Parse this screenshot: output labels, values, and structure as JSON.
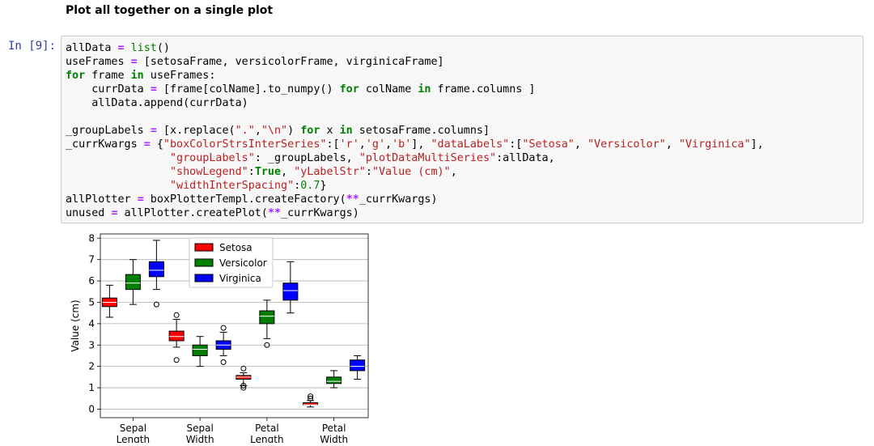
{
  "heading": "Plot all together on a single plot",
  "cell": {
    "prompt": "In [9]:",
    "lines": [
      [
        [
          "allData ",
          ""
        ],
        [
          "=",
          "o"
        ],
        [
          " ",
          ""
        ],
        [
          "list",
          "n"
        ],
        [
          "()",
          ""
        ]
      ],
      [
        [
          "useFrames ",
          ""
        ],
        [
          "=",
          "o"
        ],
        [
          " [setosaFrame, versicolorFrame, virginicaFrame]",
          ""
        ]
      ],
      [
        [
          "for",
          "k"
        ],
        [
          " frame ",
          ""
        ],
        [
          "in",
          "k"
        ],
        [
          " useFrames:",
          ""
        ]
      ],
      [
        [
          "    currData ",
          ""
        ],
        [
          "=",
          "o"
        ],
        [
          " [frame[colName]",
          ""
        ],
        [
          ".",
          ""
        ],
        [
          "to_numpy() ",
          ""
        ],
        [
          "for",
          "k"
        ],
        [
          " colName ",
          ""
        ],
        [
          "in",
          "k"
        ],
        [
          " frame",
          ""
        ],
        [
          ".",
          ""
        ],
        [
          "columns ]",
          ""
        ]
      ],
      [
        [
          "    allData",
          ""
        ],
        [
          ".",
          ""
        ],
        [
          "append(currData)",
          ""
        ]
      ],
      [
        [
          "",
          ""
        ]
      ],
      [
        [
          "_groupLabels ",
          ""
        ],
        [
          "=",
          "o"
        ],
        [
          " [x",
          ""
        ],
        [
          ".",
          ""
        ],
        [
          "replace(",
          ""
        ],
        [
          "\".\"",
          "s"
        ],
        [
          ",",
          ""
        ],
        [
          "\"\\n\"",
          "s"
        ],
        [
          ") ",
          ""
        ],
        [
          "for",
          "k"
        ],
        [
          " x ",
          ""
        ],
        [
          "in",
          "k"
        ],
        [
          " setosaFrame",
          ""
        ],
        [
          ".",
          ""
        ],
        [
          "columns]",
          ""
        ]
      ],
      [
        [
          "_currKwargs ",
          ""
        ],
        [
          "=",
          "o"
        ],
        [
          " {",
          ""
        ],
        [
          "\"boxColorStrsInterSeries\"",
          "s"
        ],
        [
          ":[",
          ""
        ],
        [
          "'r'",
          "s"
        ],
        [
          ",",
          ""
        ],
        [
          "'g'",
          "s"
        ],
        [
          ",",
          ""
        ],
        [
          "'b'",
          "s"
        ],
        [
          "], ",
          ""
        ],
        [
          "\"dataLabels\"",
          "s"
        ],
        [
          ":[",
          ""
        ],
        [
          "\"Setosa\"",
          "s"
        ],
        [
          ", ",
          ""
        ],
        [
          "\"Versicolor\"",
          "s"
        ],
        [
          ", ",
          ""
        ],
        [
          "\"Virginica\"",
          "s"
        ],
        [
          "],",
          ""
        ]
      ],
      [
        [
          "                ",
          ""
        ],
        [
          "\"groupLabels\"",
          "s"
        ],
        [
          ": _groupLabels, ",
          ""
        ],
        [
          "\"plotDataMultiSeries\"",
          "s"
        ],
        [
          ":allData,",
          ""
        ]
      ],
      [
        [
          "                ",
          ""
        ],
        [
          "\"showLegend\"",
          "s"
        ],
        [
          ":",
          ""
        ],
        [
          "True",
          "k"
        ],
        [
          ", ",
          ""
        ],
        [
          "\"yLabelStr\"",
          "s"
        ],
        [
          ":",
          ""
        ],
        [
          "\"Value (cm)\"",
          "s"
        ],
        [
          ",",
          ""
        ]
      ],
      [
        [
          "                ",
          ""
        ],
        [
          "\"widthInterSpacing\"",
          "s"
        ],
        [
          ":",
          ""
        ],
        [
          "0.7",
          "n"
        ],
        [
          "}",
          ""
        ]
      ],
      [
        [
          "allPlotter ",
          ""
        ],
        [
          "=",
          "o"
        ],
        [
          " boxPlotterTempl",
          ""
        ],
        [
          ".",
          ""
        ],
        [
          "createFactory(",
          ""
        ],
        [
          "**",
          "o"
        ],
        [
          "_currKwargs)",
          ""
        ]
      ],
      [
        [
          "unused ",
          ""
        ],
        [
          "=",
          "o"
        ],
        [
          " allPlotter",
          ""
        ],
        [
          ".",
          ""
        ],
        [
          "createPlot(",
          ""
        ],
        [
          "**",
          "o"
        ],
        [
          "_currKwargs)",
          ""
        ]
      ]
    ]
  },
  "chart_data": {
    "type": "box",
    "title": "",
    "xlabel": "",
    "ylabel": "Value (cm)",
    "ylim": [
      -0.4,
      8.2
    ],
    "yticks": [
      0,
      1,
      2,
      3,
      4,
      5,
      6,
      7,
      8
    ],
    "grid": "horizontal",
    "legend_position": "top-center",
    "categories": [
      "Sepal\nLength",
      "Sepal\nWidth",
      "Petal\nLength",
      "Petal\nWidth"
    ],
    "series": [
      {
        "name": "Setosa",
        "color": "#ff0000",
        "boxes": [
          {
            "whislo": 4.3,
            "q1": 4.8,
            "med": 5.0,
            "q3": 5.2,
            "whishi": 5.8,
            "fliers": []
          },
          {
            "whislo": 2.9,
            "q1": 3.2,
            "med": 3.4,
            "q3": 3.65,
            "whishi": 4.2,
            "fliers": [
              4.4,
              2.3
            ]
          },
          {
            "whislo": 1.1,
            "q1": 1.4,
            "med": 1.5,
            "q3": 1.575,
            "whishi": 1.7,
            "fliers": [
              1.9,
              1.0,
              1.1
            ]
          },
          {
            "whislo": 0.1,
            "q1": 0.2,
            "med": 0.2,
            "q3": 0.3,
            "whishi": 0.4,
            "fliers": [
              0.5,
              0.6
            ]
          }
        ]
      },
      {
        "name": "Versicolor",
        "color": "#008000",
        "boxes": [
          {
            "whislo": 4.9,
            "q1": 5.6,
            "med": 5.9,
            "q3": 6.3,
            "whishi": 7.0,
            "fliers": []
          },
          {
            "whislo": 2.0,
            "q1": 2.5,
            "med": 2.8,
            "q3": 3.0,
            "whishi": 3.4,
            "fliers": []
          },
          {
            "whislo": 3.3,
            "q1": 4.0,
            "med": 4.35,
            "q3": 4.6,
            "whishi": 5.1,
            "fliers": [
              3.0
            ]
          },
          {
            "whislo": 1.0,
            "q1": 1.2,
            "med": 1.3,
            "q3": 1.5,
            "whishi": 1.8,
            "fliers": []
          }
        ]
      },
      {
        "name": "Virginica",
        "color": "#0000ff",
        "boxes": [
          {
            "whislo": 5.6,
            "q1": 6.2,
            "med": 6.5,
            "q3": 6.9,
            "whishi": 7.9,
            "fliers": [
              4.9
            ]
          },
          {
            "whislo": 2.5,
            "q1": 2.8,
            "med": 3.0,
            "q3": 3.2,
            "whishi": 3.6,
            "fliers": [
              3.8,
              2.2
            ]
          },
          {
            "whislo": 4.5,
            "q1": 5.1,
            "med": 5.55,
            "q3": 5.9,
            "whishi": 6.9,
            "fliers": []
          },
          {
            "whislo": 1.4,
            "q1": 1.8,
            "med": 2.0,
            "q3": 2.3,
            "whishi": 2.5,
            "fliers": []
          }
        ]
      }
    ]
  }
}
